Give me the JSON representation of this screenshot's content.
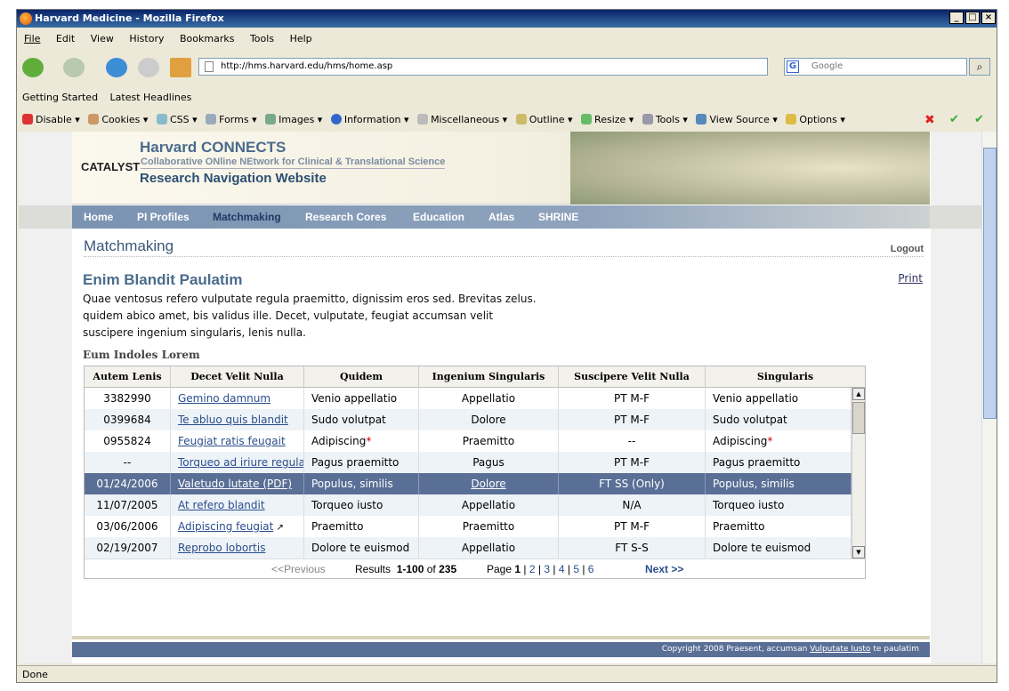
{
  "window": {
    "title": "Harvard Medicine - Mozilla Firefox"
  },
  "menu": [
    "File",
    "Edit",
    "View",
    "History",
    "Bookmarks",
    "Tools",
    "Help"
  ],
  "nav": {
    "url": "http://hms.harvard.edu/hms/home.asp",
    "search_placeholder": "Google"
  },
  "bookmarks": [
    "Getting Started",
    "Latest Headlines"
  ],
  "devbar": [
    "Disable",
    "Cookies",
    "CSS",
    "Forms",
    "Images",
    "Information",
    "Miscellaneous",
    "Outline",
    "Resize",
    "Tools",
    "View Source",
    "Options"
  ],
  "status": "Done",
  "banner": {
    "logo": "CATALYST",
    "title": "Harvard CONNECTS",
    "subtitle": "Collaborative ONline NEtwork for Clinical & Translational Science",
    "site": "Research Navigation Website"
  },
  "topnav": [
    "Home",
    "PI Profiles",
    "Matchmaking",
    "Research Cores",
    "Education",
    "Atlas",
    "SHRINE"
  ],
  "page": {
    "heading": "Matchmaking",
    "logout": "Logout",
    "title": "Enim Blandit Paulatim",
    "print": "Print",
    "intro": "Quae ventosus refero vulputate regula praemitto, dignissim eros sed. Brevitas zelus. quidem abico amet, bis validus ille. Decet, vulputate, feugiat accumsan velit suscipere ingenium singularis, lenis nulla.",
    "section": "Eum Indoles Lorem"
  },
  "table": {
    "headers": [
      "Autem Lenis",
      "Decet Velit Nulla",
      "Quidem",
      "Ingenium Singularis",
      "Suscipere Velit Nulla",
      "Singularis"
    ],
    "rows": [
      [
        "3382990",
        "Gemino damnum",
        "Venio appellatio",
        "Appellatio",
        "PT M-F",
        "Venio appellatio"
      ],
      [
        "0399684",
        "Te abluo quis blandit",
        "Sudo volutpat",
        "Dolore",
        "PT M-F",
        "Sudo volutpat"
      ],
      [
        "0955824",
        "Feugiat ratis feugait",
        "Adipiscing",
        "Praemitto",
        "--",
        "Adipiscing"
      ],
      [
        "--",
        "Torqueo ad iriure regula",
        "Pagus praemitto",
        "Pagus",
        "PT M-F",
        "Pagus praemitto"
      ],
      [
        "01/24/2006",
        "Valetudo lutate (PDF)",
        "Populus, similis",
        "Dolore",
        "FT SS (Only)",
        "Populus, similis"
      ],
      [
        "11/07/2005",
        "At refero blandit",
        "Torqueo iusto",
        "Appellatio",
        "N/A",
        "Torqueo iusto"
      ],
      [
        "03/06/2006",
        "Adipiscing feugiat",
        "Praemitto",
        "Praemitto",
        "PT M-F",
        "Praemitto"
      ],
      [
        "02/19/2007",
        "Reprobo lobortis",
        "Dolore te euismod",
        "Appellatio",
        "FT S-S",
        "Dolore te euismod"
      ]
    ],
    "selected_row": 4
  },
  "pager": {
    "prev": "<<Previous",
    "results_label": "Results",
    "range": "1-100",
    "of": "of",
    "total": "235",
    "page_label": "Page",
    "current": "1",
    "pages": [
      "2",
      "3",
      "4",
      "5",
      "6"
    ],
    "next": "Next >>"
  },
  "footer": {
    "text": "Copyright 2008 Praesent, accumsan",
    "link": "Vulputate Iusto",
    "tail": "te paulatim"
  }
}
